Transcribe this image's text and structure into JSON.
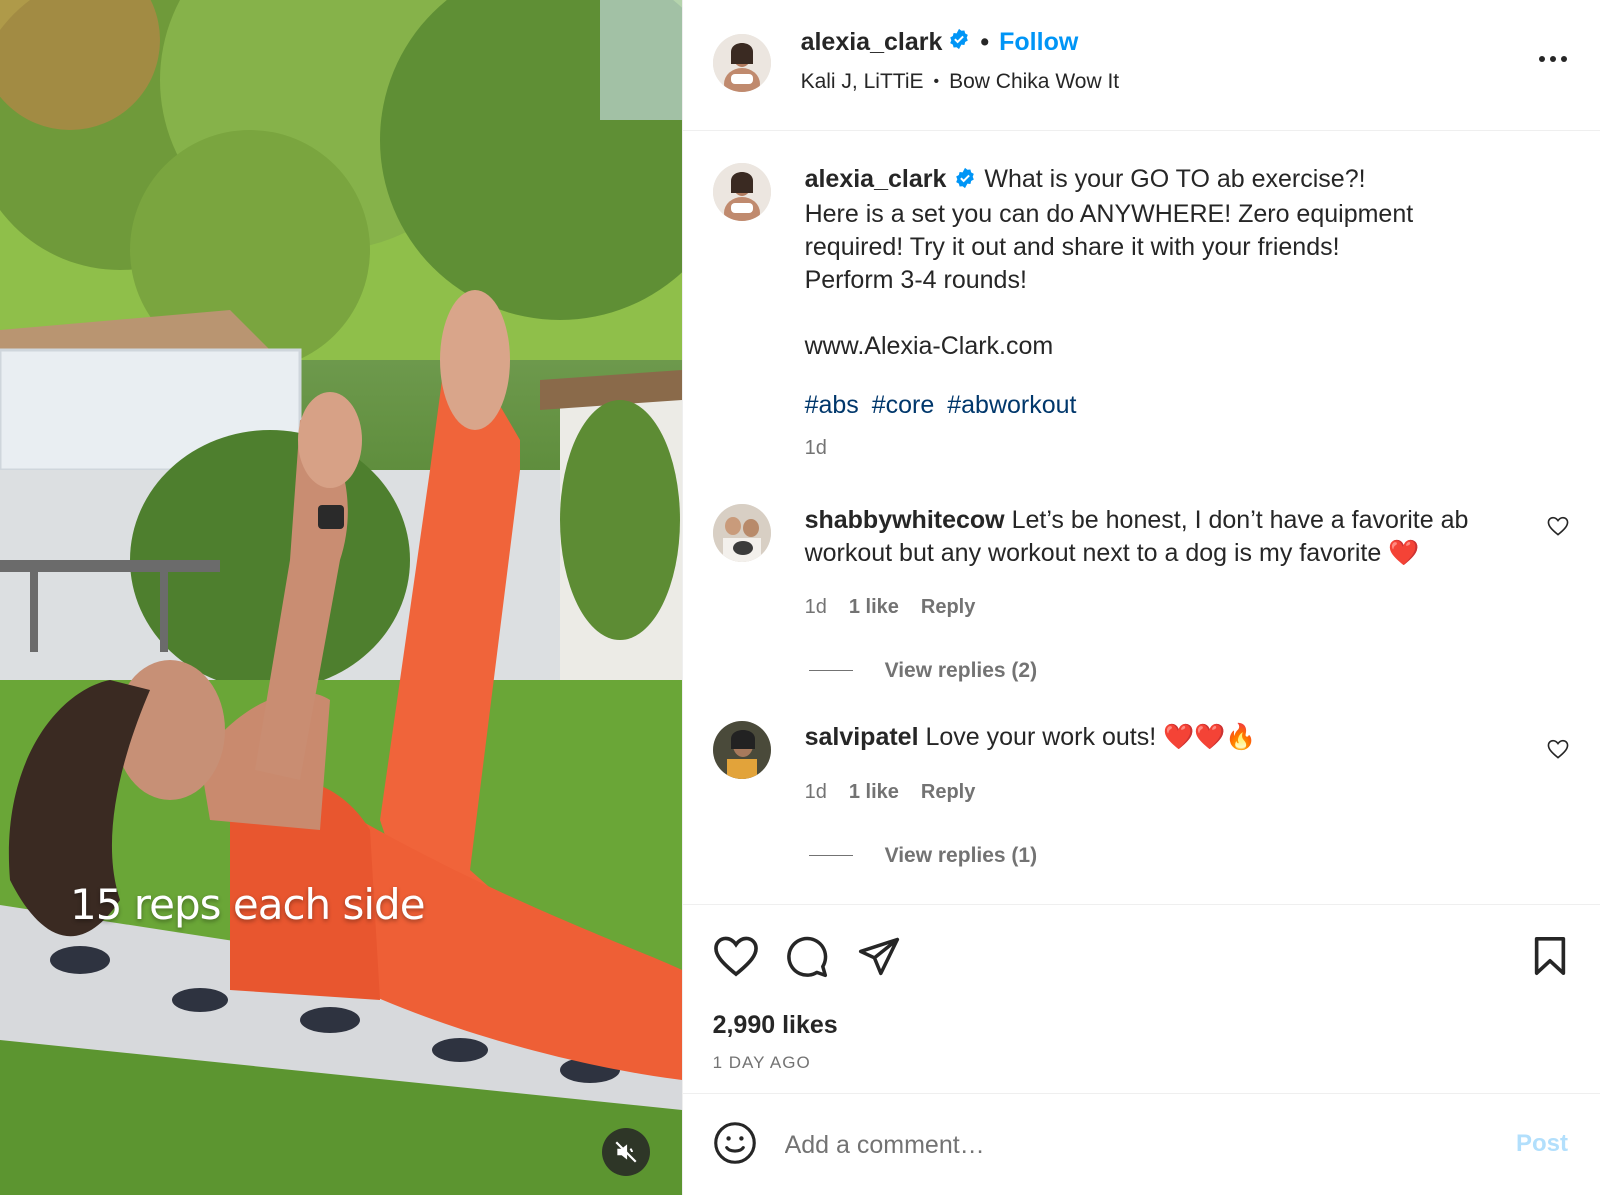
{
  "header": {
    "username": "alexia_clark",
    "verified": true,
    "follow_label": "Follow",
    "audio_artist": "Kali J, LiTTiE",
    "audio_title": "Bow Chika Wow It"
  },
  "caption": {
    "username": "alexia_clark",
    "text": "What is your GO TO ab exercise?!\nHere is a set you can do ANYWHERE! Zero equipment required! Try it out and share it with your friends!\nPerform 3-4 rounds!\n\nwww.Alexia-Clark.com",
    "hashtags": [
      "#abs",
      "#core",
      "#abworkout"
    ],
    "time": "1d"
  },
  "comments": [
    {
      "username": "shabbywhitecow",
      "text": "Let’s be honest, I don’t have a favorite ab workout but any workout next to a dog is my favorite ❤️",
      "time": "1d",
      "likes": "1 like",
      "reply_label": "Reply",
      "view_replies": "View replies (2)"
    },
    {
      "username": "salvipatel",
      "text": "Love your work outs! ❤️❤️🔥",
      "time": "1d",
      "likes": "1 like",
      "reply_label": "Reply",
      "view_replies": "View replies (1)"
    }
  ],
  "media": {
    "overlay_text": "15 reps each side"
  },
  "engagement": {
    "likes": "2,990 likes",
    "date": "1 DAY AGO"
  },
  "comment_box": {
    "placeholder": "Add a comment…",
    "post_label": "Post"
  },
  "icons": {
    "verified": "verified-badge-icon",
    "more": "more-options-icon",
    "like": "heart-icon",
    "comment": "comment-icon",
    "share": "share-icon",
    "save": "bookmark-icon",
    "emoji": "emoji-icon",
    "mute": "muted-speaker-icon"
  },
  "colors": {
    "accent": "#0095f6",
    "hashtag": "#00376b",
    "muted_text": "#737373",
    "post_disabled": "#b2dffc"
  }
}
